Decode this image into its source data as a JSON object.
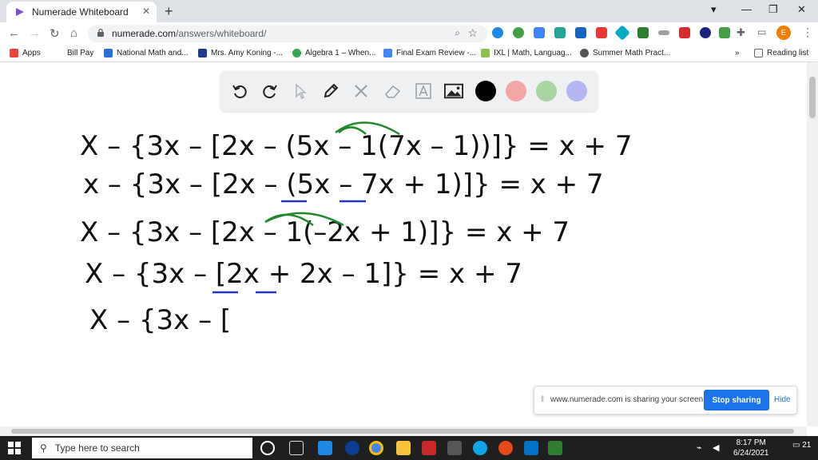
{
  "browser": {
    "tab_title": "Numerade Whiteboard",
    "url_host": "numerade.com",
    "url_path": "/answers/whiteboard/",
    "profile_initial": "E"
  },
  "bookmarks": [
    {
      "label": "Apps",
      "color": "#e8453c"
    },
    {
      "label": "Bill Pay",
      "color": "#ffffff"
    },
    {
      "label": "National Math and...",
      "color": "#2b6fd6"
    },
    {
      "label": "Mrs. Amy Koning -...",
      "color": "#1f3a93"
    },
    {
      "label": "Algebra 1 – When...",
      "color": "#34a853"
    },
    {
      "label": "Final Exam Review -...",
      "color": "#4285f4"
    },
    {
      "label": "IXL | Math, Languag...",
      "color": "#8bc34a"
    },
    {
      "label": "Summer Math Pract...",
      "color": "#555555"
    }
  ],
  "bookmarks_more": "»",
  "reading_list": "Reading list",
  "whiteboard": {
    "colors": [
      "#000000",
      "#f4a6a6",
      "#a8d5a2",
      "#b3b6f0"
    ],
    "lines": [
      "X – {3x – [2x – (5x – 1(7x – 1))]} = x + 7",
      "x – {3x – [2x – (5x – 7x + 1)]} = x + 7",
      "X – {3x – [2x – 1(–2x + 1)]} = x + 7",
      "X – {3x – [2x + 2x – 1]} = x + 7",
      "X – {3x – ["
    ]
  },
  "share_bar": {
    "message": "www.numerade.com is sharing your screen.",
    "stop_label": "Stop sharing",
    "hide_label": "Hide"
  },
  "taskbar": {
    "search_placeholder": "Type here to search",
    "time": "8:17 PM",
    "date": "6/24/2021",
    "notification_count": "21"
  }
}
